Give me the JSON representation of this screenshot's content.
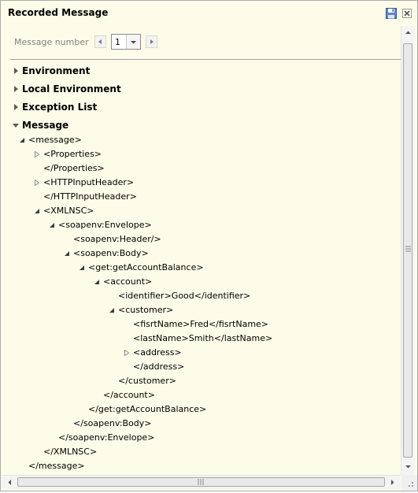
{
  "window": {
    "title": "Recorded Message"
  },
  "toolbar": {
    "save_icon": "save-icon",
    "close_icon": "close-icon"
  },
  "message_number": {
    "label": "Message number",
    "value": "1"
  },
  "sections": [
    {
      "label": "Environment",
      "expanded": false
    },
    {
      "label": "Local Environment",
      "expanded": false
    },
    {
      "label": "Exception List",
      "expanded": false
    },
    {
      "label": "Message",
      "expanded": true
    }
  ],
  "tree": [
    {
      "text": "<message>",
      "twisty": "expanded"
    },
    {
      "text": "<Properties>",
      "twisty": "collapsed"
    },
    {
      "text": "</Properties>",
      "twisty": "none"
    },
    {
      "text": "<HTTPInputHeader>",
      "twisty": "collapsed"
    },
    {
      "text": "</HTTPInputHeader>",
      "twisty": "none"
    },
    {
      "text": "<XMLNSC>",
      "twisty": "expanded"
    },
    {
      "text": "<soapenv:Envelope>",
      "twisty": "expanded"
    },
    {
      "text": "<soapenv:Header/>",
      "twisty": "none"
    },
    {
      "text": "<soapenv:Body>",
      "twisty": "expanded"
    },
    {
      "text": "<get:getAccountBalance>",
      "twisty": "expanded"
    },
    {
      "text": "<account>",
      "twisty": "expanded"
    },
    {
      "text": "<identifier>Good</identifier>",
      "twisty": "none"
    },
    {
      "text": "<customer>",
      "twisty": "expanded"
    },
    {
      "text": "<fisrtName>Fred</fisrtName>",
      "twisty": "none"
    },
    {
      "text": "<lastName>Smith</lastName>",
      "twisty": "none"
    },
    {
      "text": "<address>",
      "twisty": "collapsed"
    },
    {
      "text": "</address>",
      "twisty": "none"
    },
    {
      "text": "</customer>",
      "twisty": "none"
    },
    {
      "text": "</account>",
      "twisty": "none"
    },
    {
      "text": "</get:getAccountBalance>",
      "twisty": "none"
    },
    {
      "text": "</soapenv:Body>",
      "twisty": "none"
    },
    {
      "text": "</soapenv:Envelope>",
      "twisty": "none"
    },
    {
      "text": "</XMLNSC>",
      "twisty": "none"
    },
    {
      "text": "</message>",
      "twisty": "none"
    }
  ],
  "colors": {
    "panel_bg": "#fcfce9",
    "separator": "#a0a0a0",
    "twisty": "#5a5a5a"
  }
}
